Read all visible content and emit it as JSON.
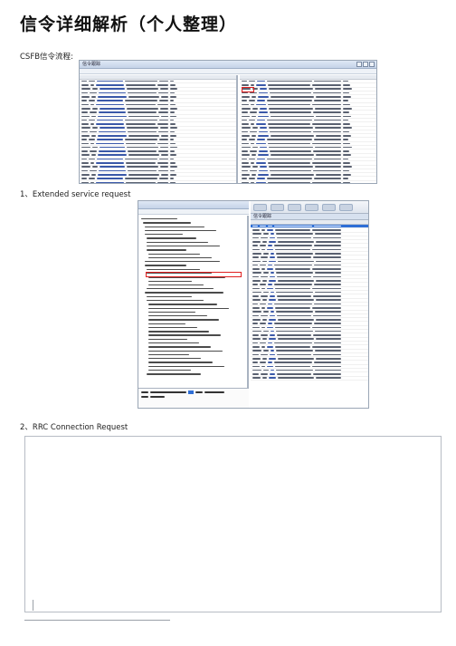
{
  "doc": {
    "title": "信令详细解析（个人整理）",
    "intro": "CSFB信令流程:",
    "section1": "1、Extended service request",
    "section2": "2、RRC Connection Request"
  },
  "screenshot_top": {
    "window_title": "信令跟踪"
  },
  "screenshot_mid": {
    "window_title": "信令跟踪",
    "panel_title": "信令跟踪"
  },
  "colors": {
    "selection": "#2f6fd6",
    "highlight_box": "#e02020"
  }
}
